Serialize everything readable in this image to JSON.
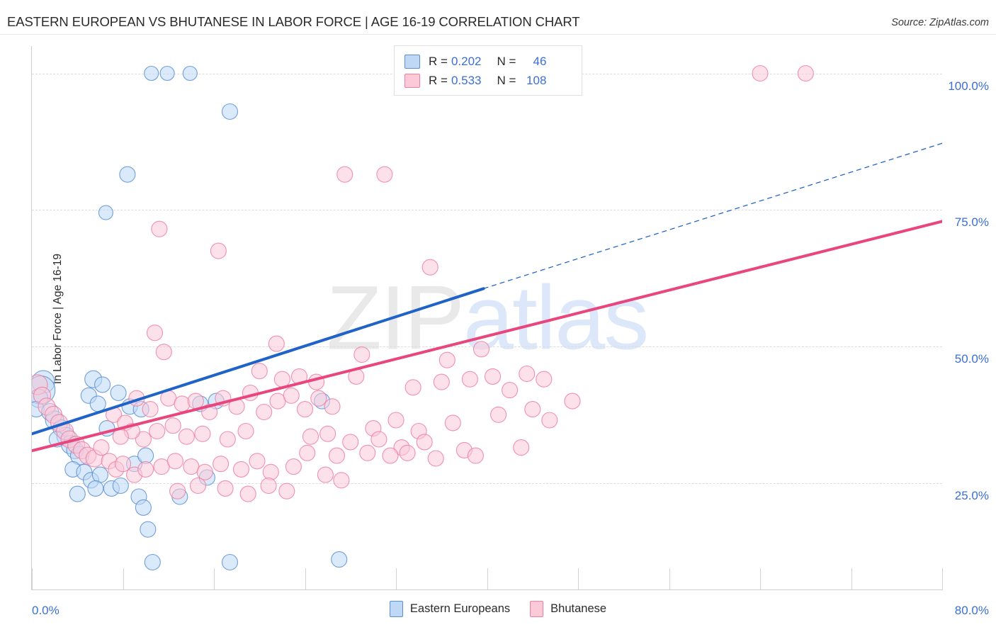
{
  "header": {
    "title": "EASTERN EUROPEAN VS BHUTANESE IN LABOR FORCE | AGE 16-19 CORRELATION CHART",
    "source": "Source: ZipAtlas.com"
  },
  "watermark": {
    "part1": "ZIP",
    "part2": "atlas"
  },
  "stats": {
    "rows": [
      {
        "r_label": "R =",
        "r_value": "0.202",
        "n_label": "N =",
        "n_value": "46",
        "color": "#bed8f5"
      },
      {
        "r_label": "R =",
        "r_value": "0.533",
        "n_label": "N =",
        "n_value": "108",
        "color": "#fbc9d8"
      }
    ]
  },
  "legend": {
    "items": [
      {
        "label": "Eastern Europeans",
        "color": "#bed8f5"
      },
      {
        "label": "Bhutanese",
        "color": "#fbc9d8"
      }
    ]
  },
  "chart_data": {
    "type": "scatter",
    "title": "EASTERN EUROPEAN VS BHUTANESE IN LABOR FORCE | AGE 16-19 CORRELATION CHART",
    "xlabel": "",
    "ylabel": "In Labor Force | Age 16-19",
    "xlim": [
      0,
      80
    ],
    "ylim": [
      5.5,
      105
    ],
    "grid": true,
    "legend_position": "bottom-center",
    "x_ticks": [
      "0.0%",
      "80.0%"
    ],
    "x_tick_values": [
      0,
      8,
      16,
      24,
      32,
      40,
      48,
      56,
      64,
      72,
      80
    ],
    "y_ticks": [
      "25.0%",
      "50.0%",
      "75.0%",
      "100.0%"
    ],
    "y_tick_values": [
      25,
      50,
      75,
      100
    ],
    "accent_blue": "#3b6fd4",
    "accent_pink": "#e8467c",
    "series": [
      {
        "name": "Eastern Europeans",
        "color": "#bed8f5",
        "edge": "#5b8fd4",
        "R": 0.202,
        "N": 46,
        "trend": {
          "x0": 0,
          "y0": 34.0,
          "x1": 39.7,
          "y1": 60.6,
          "dash_x0": 39.7,
          "dash_y0": 60.6,
          "dash_x1": 80,
          "dash_y1": 87.2
        },
        "points": [
          [
            10.5,
            100.0,
            10
          ],
          [
            11.9,
            100.0,
            10
          ],
          [
            13.9,
            100.0,
            10
          ],
          [
            17.4,
            93.0,
            11
          ],
          [
            8.4,
            81.5,
            11
          ],
          [
            6.5,
            74.5,
            10
          ],
          [
            1.0,
            43.5,
            16
          ],
          [
            0.8,
            42.0,
            20
          ],
          [
            0.6,
            40.5,
            13
          ],
          [
            0.4,
            38.5,
            11
          ],
          [
            1.6,
            38.0,
            12
          ],
          [
            2.0,
            36.5,
            13
          ],
          [
            2.6,
            35.0,
            12
          ],
          [
            3.0,
            33.5,
            13
          ],
          [
            3.4,
            32.0,
            13
          ],
          [
            3.8,
            31.0,
            12
          ],
          [
            4.2,
            30.0,
            13
          ],
          [
            2.2,
            33.0,
            11
          ],
          [
            5.4,
            44.0,
            12
          ],
          [
            6.2,
            43.0,
            11
          ],
          [
            5.0,
            41.0,
            11
          ],
          [
            5.8,
            39.5,
            11
          ],
          [
            7.6,
            41.5,
            11
          ],
          [
            8.6,
            39.0,
            11
          ],
          [
            6.6,
            35.0,
            11
          ],
          [
            9.6,
            38.5,
            11
          ],
          [
            14.8,
            39.5,
            11
          ],
          [
            16.2,
            40.0,
            11
          ],
          [
            25.5,
            40.0,
            11
          ],
          [
            3.6,
            27.5,
            11
          ],
          [
            4.6,
            27.0,
            11
          ],
          [
            5.2,
            25.5,
            11
          ],
          [
            6.0,
            26.5,
            11
          ],
          [
            4.0,
            23.0,
            11
          ],
          [
            5.6,
            24.0,
            11
          ],
          [
            7.0,
            24.0,
            11
          ],
          [
            7.8,
            24.5,
            11
          ],
          [
            9.0,
            28.5,
            11
          ],
          [
            9.4,
            22.5,
            11
          ],
          [
            9.8,
            20.5,
            11
          ],
          [
            10.0,
            30.0,
            11
          ],
          [
            10.2,
            16.5,
            11
          ],
          [
            13.0,
            22.5,
            11
          ],
          [
            15.4,
            26.0,
            11
          ],
          [
            10.6,
            10.5,
            11
          ],
          [
            17.4,
            10.5,
            11
          ],
          [
            27.0,
            11.0,
            11
          ]
        ]
      },
      {
        "name": "Bhutanese",
        "color": "#fbc9d8",
        "edge": "#ee7fa0",
        "R": 0.533,
        "N": 108,
        "trend": {
          "x0": 0,
          "y0": 30.9,
          "x1": 80,
          "y1": 72.9
        },
        "points": [
          [
            64.0,
            100.0,
            11
          ],
          [
            68.0,
            100.0,
            11
          ],
          [
            27.5,
            81.5,
            11
          ],
          [
            31.0,
            81.5,
            11
          ],
          [
            11.2,
            71.5,
            11
          ],
          [
            16.4,
            67.5,
            11
          ],
          [
            35.0,
            64.5,
            11
          ],
          [
            10.8,
            52.5,
            11
          ],
          [
            11.6,
            49.0,
            11
          ],
          [
            21.5,
            50.5,
            11
          ],
          [
            29.0,
            48.5,
            11
          ],
          [
            36.5,
            47.5,
            11
          ],
          [
            39.5,
            49.5,
            11
          ],
          [
            43.5,
            45.0,
            11
          ],
          [
            20.0,
            45.5,
            11
          ],
          [
            22.0,
            44.0,
            11
          ],
          [
            23.5,
            44.5,
            11
          ],
          [
            25.0,
            43.5,
            11
          ],
          [
            28.5,
            44.5,
            11
          ],
          [
            33.5,
            42.5,
            11
          ],
          [
            36.0,
            43.5,
            11
          ],
          [
            38.5,
            44.0,
            11
          ],
          [
            40.5,
            44.5,
            11
          ],
          [
            42.0,
            42.0,
            11
          ],
          [
            45.0,
            44.0,
            11
          ],
          [
            0.5,
            43.0,
            14
          ],
          [
            0.9,
            41.0,
            12
          ],
          [
            1.3,
            39.0,
            12
          ],
          [
            1.9,
            37.5,
            12
          ],
          [
            2.4,
            36.0,
            12
          ],
          [
            2.9,
            34.5,
            12
          ],
          [
            3.3,
            33.0,
            12
          ],
          [
            3.9,
            32.0,
            12
          ],
          [
            4.4,
            31.0,
            12
          ],
          [
            4.9,
            30.0,
            12
          ],
          [
            5.5,
            29.5,
            12
          ],
          [
            6.1,
            31.5,
            11
          ],
          [
            7.2,
            37.5,
            11
          ],
          [
            8.2,
            36.0,
            11
          ],
          [
            9.2,
            40.5,
            11
          ],
          [
            10.4,
            38.5,
            11
          ],
          [
            12.0,
            40.5,
            11
          ],
          [
            13.2,
            39.5,
            11
          ],
          [
            14.4,
            40.0,
            11
          ],
          [
            15.6,
            38.0,
            11
          ],
          [
            16.8,
            40.5,
            11
          ],
          [
            18.0,
            39.0,
            11
          ],
          [
            19.2,
            41.5,
            11
          ],
          [
            20.4,
            38.0,
            11
          ],
          [
            21.6,
            40.0,
            11
          ],
          [
            22.8,
            41.0,
            11
          ],
          [
            24.0,
            38.5,
            11
          ],
          [
            25.2,
            40.5,
            11
          ],
          [
            26.4,
            39.0,
            11
          ],
          [
            44.0,
            38.5,
            11
          ],
          [
            47.5,
            40.0,
            11
          ],
          [
            30.0,
            35.0,
            11
          ],
          [
            32.0,
            36.5,
            11
          ],
          [
            34.0,
            34.5,
            11
          ],
          [
            37.0,
            36.0,
            11
          ],
          [
            41.0,
            37.5,
            11
          ],
          [
            30.5,
            33.0,
            11
          ],
          [
            32.5,
            31.5,
            11
          ],
          [
            34.5,
            32.5,
            11
          ],
          [
            28.0,
            32.5,
            11
          ],
          [
            26.0,
            34.0,
            11
          ],
          [
            24.5,
            33.5,
            11
          ],
          [
            18.8,
            34.5,
            11
          ],
          [
            17.2,
            33.0,
            11
          ],
          [
            15.0,
            34.0,
            11
          ],
          [
            13.6,
            33.5,
            11
          ],
          [
            12.4,
            35.5,
            11
          ],
          [
            11.0,
            34.5,
            11
          ],
          [
            9.8,
            33.0,
            11
          ],
          [
            8.8,
            34.5,
            11
          ],
          [
            7.8,
            33.5,
            11
          ],
          [
            6.8,
            29.0,
            11
          ],
          [
            7.4,
            27.5,
            11
          ],
          [
            8.0,
            28.5,
            11
          ],
          [
            9.0,
            26.5,
            11
          ],
          [
            10.0,
            27.5,
            11
          ],
          [
            11.4,
            28.0,
            11
          ],
          [
            12.6,
            29.0,
            11
          ],
          [
            14.0,
            28.0,
            11
          ],
          [
            15.2,
            27.0,
            11
          ],
          [
            16.6,
            28.5,
            11
          ],
          [
            18.4,
            27.5,
            11
          ],
          [
            19.8,
            29.0,
            11
          ],
          [
            21.0,
            27.0,
            11
          ],
          [
            23.0,
            28.0,
            11
          ],
          [
            12.8,
            23.5,
            11
          ],
          [
            14.6,
            24.5,
            11
          ],
          [
            17.0,
            24.0,
            11
          ],
          [
            19.0,
            23.0,
            11
          ],
          [
            20.8,
            24.5,
            11
          ],
          [
            22.4,
            23.5,
            11
          ],
          [
            25.8,
            26.5,
            11
          ],
          [
            27.2,
            25.5,
            11
          ],
          [
            29.5,
            30.5,
            11
          ],
          [
            31.5,
            30.0,
            11
          ],
          [
            33.0,
            30.5,
            11
          ],
          [
            35.5,
            29.5,
            11
          ],
          [
            38.0,
            31.0,
            11
          ],
          [
            39.0,
            30.0,
            11
          ],
          [
            43.0,
            31.5,
            11
          ],
          [
            26.8,
            30.0,
            11
          ],
          [
            24.2,
            30.5,
            11
          ],
          [
            45.5,
            36.5,
            11
          ]
        ]
      }
    ]
  }
}
